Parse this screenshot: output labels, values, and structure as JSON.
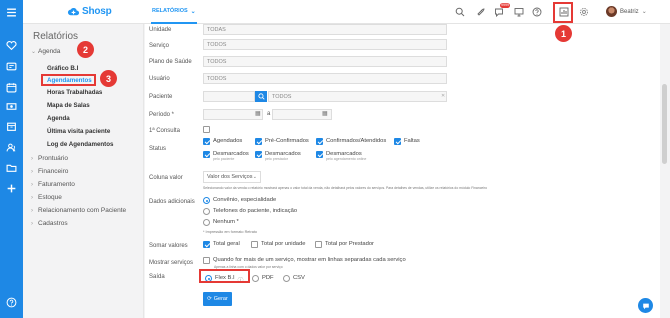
{
  "topbar": {
    "logo_text": "Shosp",
    "nav_label": "RELATÓRIOS",
    "notifications_badge": "9999",
    "user_name": "Beatriz"
  },
  "sidebar": {
    "title": "Relatórios",
    "group_open": "Agenda",
    "sub_items": [
      "Gráfico B.I",
      "Agendamentos",
      "Horas Trabalhadas",
      "Mapa de Salas",
      "Agenda",
      "Última visita paciente",
      "Log de Agendamentos"
    ],
    "groups": [
      "Prontuário",
      "Financeiro",
      "Faturamento",
      "Estoque",
      "Relacionamento com Paciente",
      "Cadastros"
    ]
  },
  "form": {
    "labels": {
      "unidade": "Unidade",
      "servico": "Serviço",
      "plano": "Plano de Saúde",
      "usuario": "Usuário",
      "paciente": "Paciente",
      "periodo": "Período *",
      "primeira": "1ª Consulta",
      "status": "Status",
      "coluna": "Coluna valor",
      "dados": "Dados adicionais",
      "somar": "Somar valores",
      "mostrar": "Mostrar serviços",
      "saida": "Saída"
    },
    "values": {
      "unidade": "TODAS",
      "servico": "TODOS",
      "plano": "TODOS",
      "usuario": "TODOS",
      "paciente": "TODOS",
      "periodo_sep": "a"
    },
    "status_opts": [
      {
        "label": "Agendados",
        "sub": ""
      },
      {
        "label": "Pré-Confirmados",
        "sub": ""
      },
      {
        "label": "Confirmados/Atendidos",
        "sub": ""
      },
      {
        "label": "Faltas",
        "sub": ""
      },
      {
        "label": "Desmarcados",
        "sub": "pelo paciente"
      },
      {
        "label": "Desmarcados",
        "sub": "pelo prestador"
      },
      {
        "label": "Desmarcados",
        "sub": "pelo agendamento online"
      }
    ],
    "coluna_select": "Valor dos Serviços",
    "coluna_note": "Selecionando valor da venda o relatório mostrará apenas o valor total da venda, não detalhará pelos valores do serviços. Para detalhes de vendas, utilize os relatórios do módulo Financeiro",
    "dados_opts": [
      "Convênio, especialidade",
      "Telefones do paciente, indicação",
      "Nenhum *"
    ],
    "dados_note": "* Impressão em formato Retrato",
    "somar_opts": [
      "Total geral",
      "Total por unidade",
      "Total por Prestador"
    ],
    "mostrar_text": "Quando for mais de um serviço, mostrar em linhas separadas cada serviço",
    "mostrar_note": "Apenas a linha com o dados valor por serviço",
    "saida_opts": [
      "Flex B.I",
      "PDF",
      "CSV"
    ],
    "generate_label": "Gerar"
  },
  "annotations": [
    "1",
    "2",
    "3"
  ],
  "colors": {
    "accent": "#1e88e5",
    "annotation": "#e53935"
  }
}
